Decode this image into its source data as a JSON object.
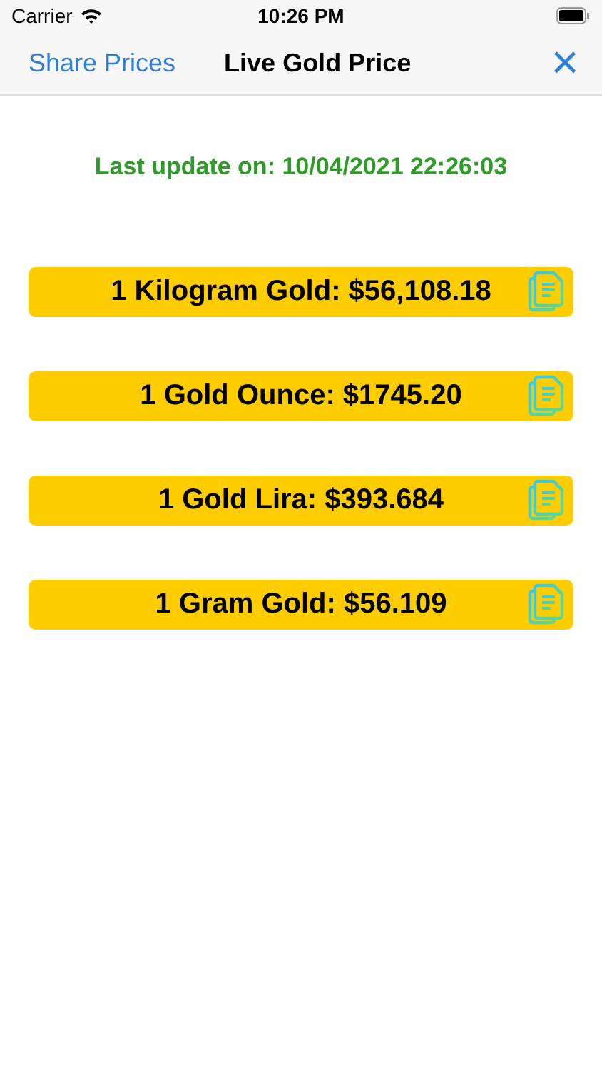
{
  "status_bar": {
    "carrier": "Carrier",
    "time": "10:26 PM"
  },
  "nav": {
    "left": "Share Prices",
    "title": "Live Gold Price",
    "close": "×"
  },
  "last_update": "Last update on: 10/04/2021 22:26:03",
  "prices": [
    {
      "label": "1 Kilogram Gold: $56,108.18"
    },
    {
      "label": "1 Gold Ounce: $1745.20"
    },
    {
      "label": "1 Gold Lira: $393.684"
    },
    {
      "label": "1 Gram Gold: $56.109"
    }
  ]
}
